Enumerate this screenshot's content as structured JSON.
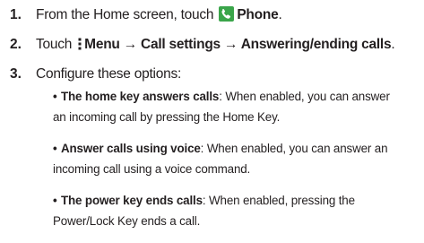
{
  "steps": [
    {
      "num": "1.",
      "pre": "From the Home screen, touch ",
      "bold": "Phone",
      "post": "."
    },
    {
      "num": "2.",
      "pre": "Touch ",
      "menu_label": "Menu",
      "arrow": " → ",
      "call_settings": "Call settings",
      "answering": "Answering/ending calls",
      "post": "."
    },
    {
      "num": "3.",
      "text": "Configure these options:"
    }
  ],
  "options": [
    {
      "title": "The home key answers calls",
      "line1_rest": ": When enabled, you can answer",
      "line2": "an incoming call by pressing the Home Key."
    },
    {
      "title": "Answer calls using voice",
      "line1_rest": ": When enabled, you can answer an",
      "line2": "incoming call using a voice command."
    },
    {
      "title": "The power key ends calls",
      "line1_rest": ": When enabled, pressing the",
      "line2": "Power/Lock Key ends a call."
    }
  ],
  "icons": {
    "phone": "phone-icon",
    "menu": "menu-dots-icon"
  },
  "colors": {
    "phone_icon_bg": "#3aa54a",
    "text": "#231f20"
  }
}
